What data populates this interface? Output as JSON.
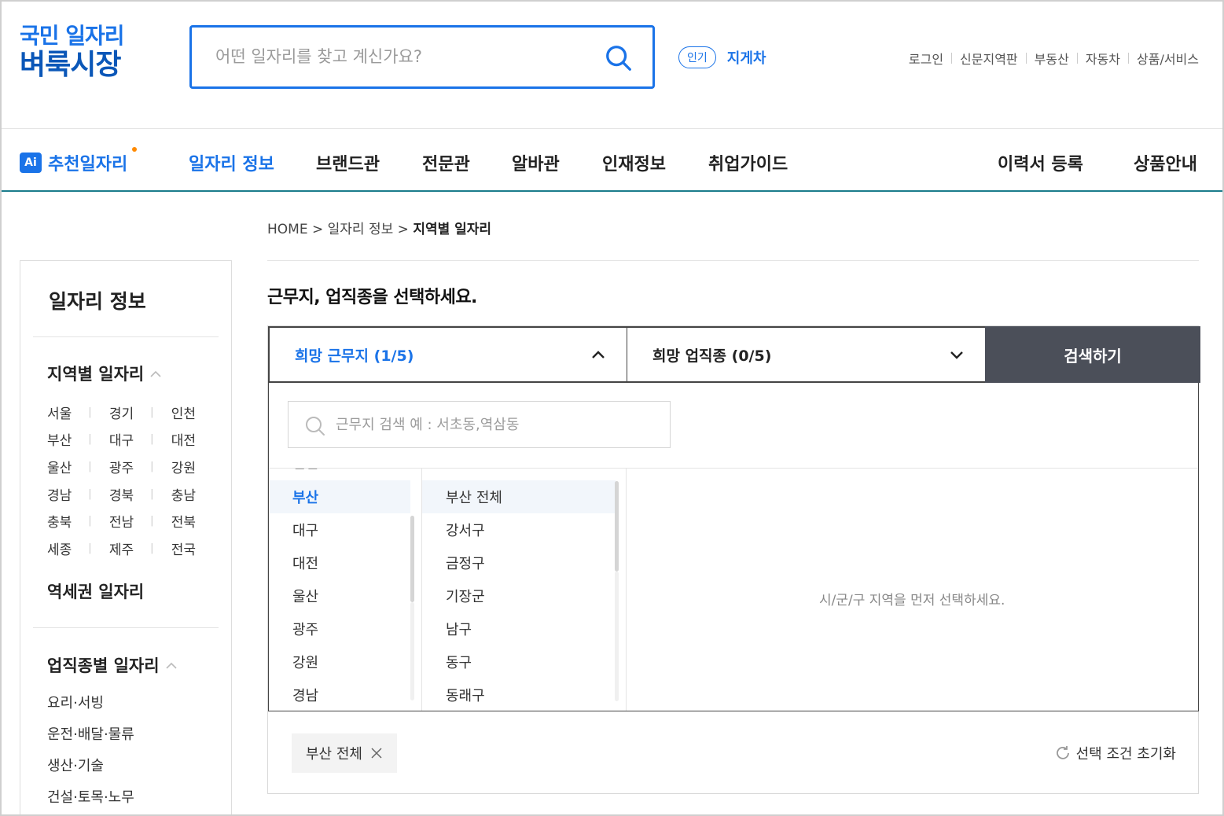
{
  "logo": {
    "line1": "국민 일자리",
    "line2": "벼룩시장"
  },
  "search": {
    "placeholder": "어떤 일자리를 찾고 계신가요?"
  },
  "popular": {
    "badge": "인기",
    "keyword": "지게차"
  },
  "toplinks": [
    "로그인",
    "신문지역판",
    "부동산",
    "자동차",
    "상품/서비스"
  ],
  "nav": {
    "ai_badge": "Ai",
    "ai_label": "추천일자리",
    "items": [
      "일자리 정보",
      "브랜드관",
      "전문관",
      "알바관",
      "인재정보",
      "취업가이드",
      "이력서 등록",
      "상품안내"
    ]
  },
  "sidebar": {
    "title": "일자리 정보",
    "region_heading": "지역별 일자리",
    "regions": [
      [
        "서울",
        "경기",
        "인천"
      ],
      [
        "부산",
        "대구",
        "대전"
      ],
      [
        "울산",
        "광주",
        "강원"
      ],
      [
        "경남",
        "경북",
        "충남"
      ],
      [
        "충북",
        "전남",
        "전북"
      ],
      [
        "세종",
        "제주",
        "전국"
      ]
    ],
    "station_heading": "역세권 일자리",
    "job_heading": "업직종별 일자리",
    "jobs": [
      "요리·서빙",
      "운전·배달·물류",
      "생산·기술",
      "건설·토목·노무"
    ]
  },
  "breadcrumb": {
    "home": "HOME",
    "sep": ">",
    "level1": "일자리 정보",
    "current": "지역별 일자리"
  },
  "headline": "근무지, 업직종을 선택하세요.",
  "tabs": {
    "location": "희망 근무지 (1/5)",
    "jobtype": "희망 업직종 (0/5)",
    "search_button": "검색하기"
  },
  "dropdown": {
    "search_placeholder": "근무지 검색 예 : 서초동,역삼동",
    "partial_top": "인천",
    "regions": [
      "부산",
      "대구",
      "대전",
      "울산",
      "광주",
      "강원",
      "경남"
    ],
    "districts": [
      "부산 전체",
      "강서구",
      "금정구",
      "기장군",
      "남구",
      "동구",
      "동래구"
    ],
    "hint": "시/군/구 지역을 먼저 선택하세요."
  },
  "selected_chip": "부산 전체",
  "reset_label": "선택 조건 초기화",
  "colors": {
    "accent": "#1a73e8",
    "dark_button": "#4b4f59",
    "nav_underline": "#1b7c8c",
    "ai_dot": "#ff8a00"
  }
}
